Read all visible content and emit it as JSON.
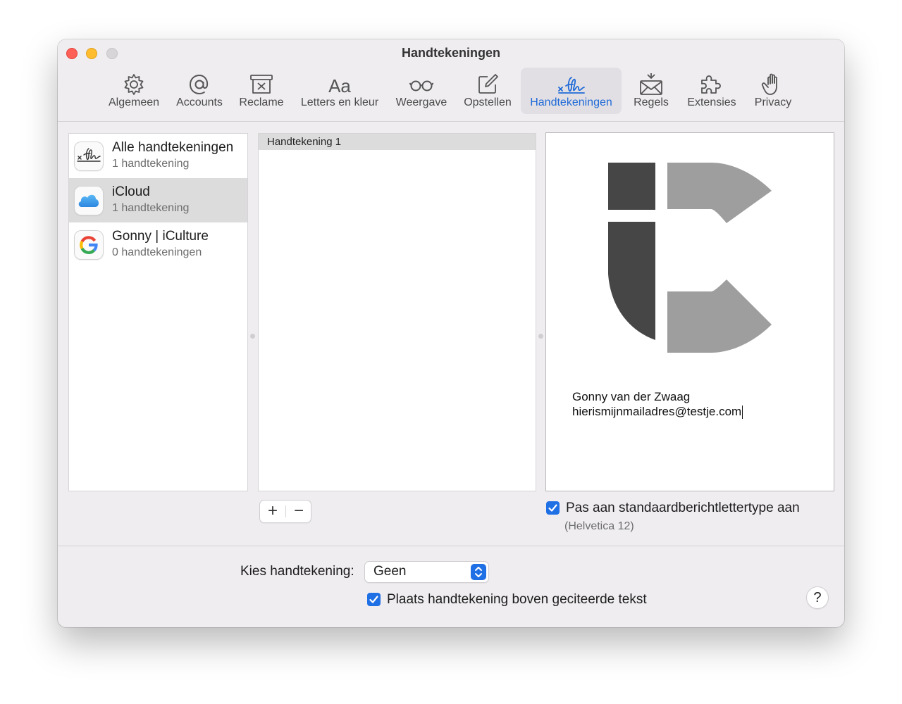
{
  "window": {
    "title": "Handtekeningen"
  },
  "toolbar": {
    "items": [
      {
        "label": "Algemeen",
        "icon": "gear-icon"
      },
      {
        "label": "Accounts",
        "icon": "at-icon"
      },
      {
        "label": "Reclame",
        "icon": "junk-icon"
      },
      {
        "label": "Letters en kleur",
        "icon": "fonts-icon"
      },
      {
        "label": "Weergave",
        "icon": "glasses-icon"
      },
      {
        "label": "Opstellen",
        "icon": "compose-icon"
      },
      {
        "label": "Handtekeningen",
        "icon": "signature-icon",
        "selected": true
      },
      {
        "label": "Regels",
        "icon": "rules-icon"
      },
      {
        "label": "Extensies",
        "icon": "puzzle-icon"
      },
      {
        "label": "Privacy",
        "icon": "hand-icon"
      }
    ],
    "accent": "#1f6ad8"
  },
  "accounts": [
    {
      "name": "Alle handtekeningen",
      "count": "1 handtekening",
      "icon": "signature-icon"
    },
    {
      "name": "iCloud",
      "count": "1 handtekening",
      "icon": "icloud-icon",
      "selected": true
    },
    {
      "name": "Gonny | iCulture",
      "count": "0 handtekeningen",
      "icon": "google-icon"
    }
  ],
  "signatures": [
    {
      "name": "Handtekening 1"
    }
  ],
  "preview": {
    "name": "Gonny van der Zwaag",
    "email": "hierismijnmailadres@testje.com",
    "logo": "iculture-logo"
  },
  "buttons": {
    "add": "+",
    "remove": "−",
    "help": "?"
  },
  "options": {
    "match_font_label": "Pas aan standaardberichtlettertype aan",
    "match_font_checked": true,
    "font_note": "(Helvetica 12)",
    "choose_label": "Kies handtekening:",
    "choose_value": "Geen",
    "place_above_label": "Plaats handtekening boven geciteerde tekst",
    "place_above_checked": true
  }
}
